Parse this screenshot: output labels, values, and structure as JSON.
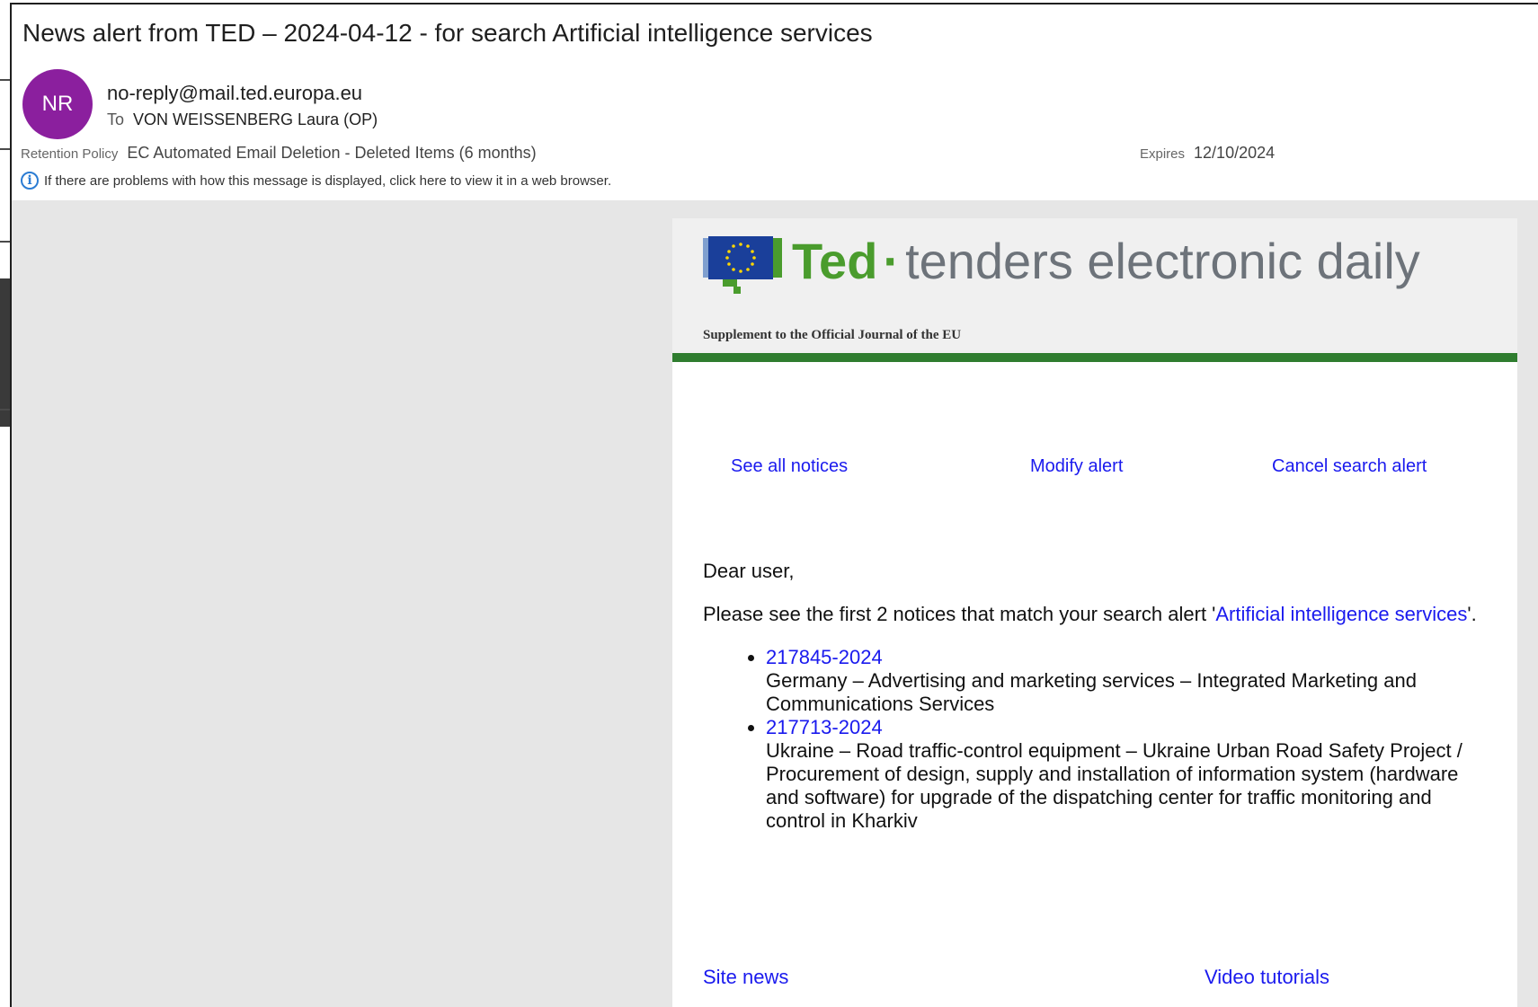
{
  "header": {
    "subject": "News alert from TED – 2024-04-12 - for search Artificial intelligence services",
    "avatar_initials": "NR",
    "avatar_color": "#8b1f9e",
    "sender": "no-reply@mail.ted.europa.eu",
    "to_label": "To",
    "to_value": "VON WEISSENBERG Laura (OP)",
    "retention_label": "Retention Policy",
    "retention_value": "EC Automated Email Deletion - Deleted Items (6 months)",
    "expires_label": "Expires",
    "expires_value": "12/10/2024",
    "info_text": "If there are problems with how this message is displayed, click here to view it in a web browser."
  },
  "banner": {
    "brand": "Ted",
    "separator": "·",
    "tagline": "tenders electronic daily",
    "supplement": "Supplement to the Official Journal of the EU",
    "brand_color": "#4a9c2d",
    "bar_color": "#2f7d2f"
  },
  "links": {
    "see_all": "See all notices",
    "modify": "Modify alert",
    "cancel": "Cancel search alert"
  },
  "content": {
    "greeting": "Dear user,",
    "intro_before": "Please see the first 2 notices that match your search alert '",
    "intro_link": "Artificial intelligence services",
    "intro_after": "'.",
    "notices": [
      {
        "id": "217845-2024",
        "desc": "Germany – Advertising and marketing services – Integrated Marketing and Communications Services"
      },
      {
        "id": "217713-2024",
        "desc": "Ukraine – Road traffic-control equipment – Ukraine Urban Road Safety Project / Procurement of design, supply and installation of information system (hardware and software) for upgrade of the dispatching center for traffic monitoring and control in Kharkiv"
      }
    ]
  },
  "footer": {
    "site_news": "Site news",
    "video_tutorials": "Video tutorials"
  }
}
